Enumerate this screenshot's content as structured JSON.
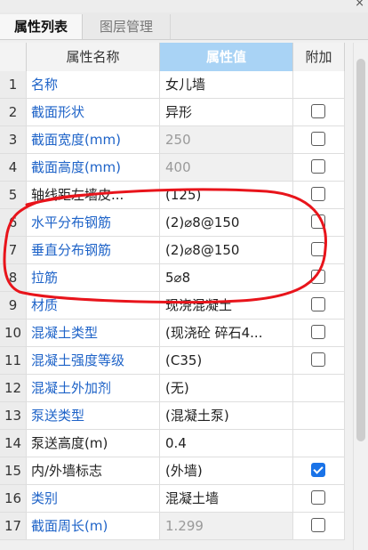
{
  "window": {
    "close_icon": "×"
  },
  "tabs": [
    {
      "label": "属性列表",
      "active": true
    },
    {
      "label": "图层管理",
      "active": false
    }
  ],
  "columns": {
    "name": "属性名称",
    "value": "属性值",
    "attach": "附加"
  },
  "rows": [
    {
      "num": "1",
      "name": "名称",
      "value": "女儿墙",
      "name_color": "blue",
      "value_gray": false,
      "checkbox": "none"
    },
    {
      "num": "2",
      "name": "截面形状",
      "value": "异形",
      "name_color": "blue",
      "value_gray": false,
      "checkbox": "unchecked"
    },
    {
      "num": "3",
      "name": "截面宽度(mm)",
      "value": "250",
      "name_color": "blue",
      "value_gray": true,
      "checkbox": "unchecked"
    },
    {
      "num": "4",
      "name": "截面高度(mm)",
      "value": "400",
      "name_color": "blue",
      "value_gray": true,
      "checkbox": "unchecked"
    },
    {
      "num": "5",
      "name": "轴线距左墙皮...",
      "value": "(125)",
      "name_color": "dark",
      "value_gray": false,
      "checkbox": "unchecked"
    },
    {
      "num": "6",
      "name": "水平分布钢筋",
      "value": "(2)⌀8@150",
      "name_color": "blue",
      "value_gray": false,
      "checkbox": "unchecked"
    },
    {
      "num": "7",
      "name": "垂直分布钢筋",
      "value": "(2)⌀8@150",
      "name_color": "blue",
      "value_gray": false,
      "checkbox": "unchecked"
    },
    {
      "num": "8",
      "name": "拉筋",
      "value": "5⌀8",
      "name_color": "blue",
      "value_gray": false,
      "checkbox": "unchecked"
    },
    {
      "num": "9",
      "name": "材质",
      "value": "现浇混凝土",
      "name_color": "blue",
      "value_gray": false,
      "checkbox": "unchecked"
    },
    {
      "num": "10",
      "name": "混凝土类型",
      "value": "(现浇砼 碎石4...",
      "name_color": "blue",
      "value_gray": false,
      "checkbox": "unchecked"
    },
    {
      "num": "11",
      "name": "混凝土强度等级",
      "value": "(C35)",
      "name_color": "blue",
      "value_gray": false,
      "checkbox": "unchecked"
    },
    {
      "num": "12",
      "name": "混凝土外加剂",
      "value": "(无)",
      "name_color": "blue",
      "value_gray": false,
      "checkbox": "none"
    },
    {
      "num": "13",
      "name": "泵送类型",
      "value": "(混凝土泵)",
      "name_color": "blue",
      "value_gray": false,
      "checkbox": "none"
    },
    {
      "num": "14",
      "name": "泵送高度(m)",
      "value": "0.4",
      "name_color": "dark",
      "value_gray": false,
      "checkbox": "none"
    },
    {
      "num": "15",
      "name": "内/外墙标志",
      "value": "(外墙)",
      "name_color": "dark",
      "value_gray": false,
      "checkbox": "checked"
    },
    {
      "num": "16",
      "name": "类别",
      "value": "混凝土墙",
      "name_color": "blue",
      "value_gray": false,
      "checkbox": "unchecked"
    },
    {
      "num": "17",
      "name": "截面周长(m)",
      "value": "1.299",
      "name_color": "blue",
      "value_gray": true,
      "checkbox": "unchecked"
    }
  ],
  "annotation": {
    "shape": "hand-drawn-ellipse",
    "color": "#e8141b"
  }
}
